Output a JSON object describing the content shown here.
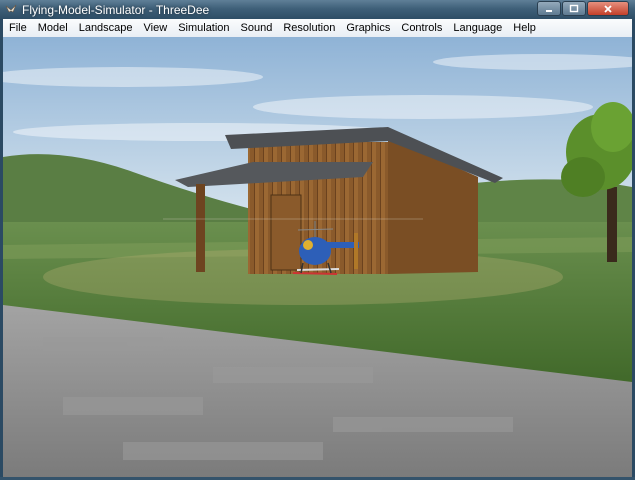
{
  "window": {
    "title": "Flying-Model-Simulator - ThreeDee",
    "app_icon": "bird-icon",
    "controls": {
      "minimize": "minimize-icon",
      "maximize": "maximize-icon",
      "close": "close-icon"
    }
  },
  "menu": {
    "items": [
      {
        "label": "File"
      },
      {
        "label": "Model"
      },
      {
        "label": "Landscape"
      },
      {
        "label": "View"
      },
      {
        "label": "Simulation"
      },
      {
        "label": "Sound"
      },
      {
        "label": "Resolution"
      },
      {
        "label": "Graphics"
      },
      {
        "label": "Controls"
      },
      {
        "label": "Language"
      },
      {
        "label": "Help"
      }
    ]
  },
  "scene": {
    "objects": [
      "sky",
      "hills",
      "grass-field",
      "wooden-shed",
      "model-helicopter",
      "tree",
      "runway"
    ],
    "colors": {
      "sky_top": "#8fb3d6",
      "sky_bottom": "#dce8f0",
      "grass": "#4f7a33",
      "wood": "#8a5a2b",
      "roof": "#55585c",
      "runway": "#8d8d8d",
      "helicopter_body": "#2d5fb8"
    }
  }
}
